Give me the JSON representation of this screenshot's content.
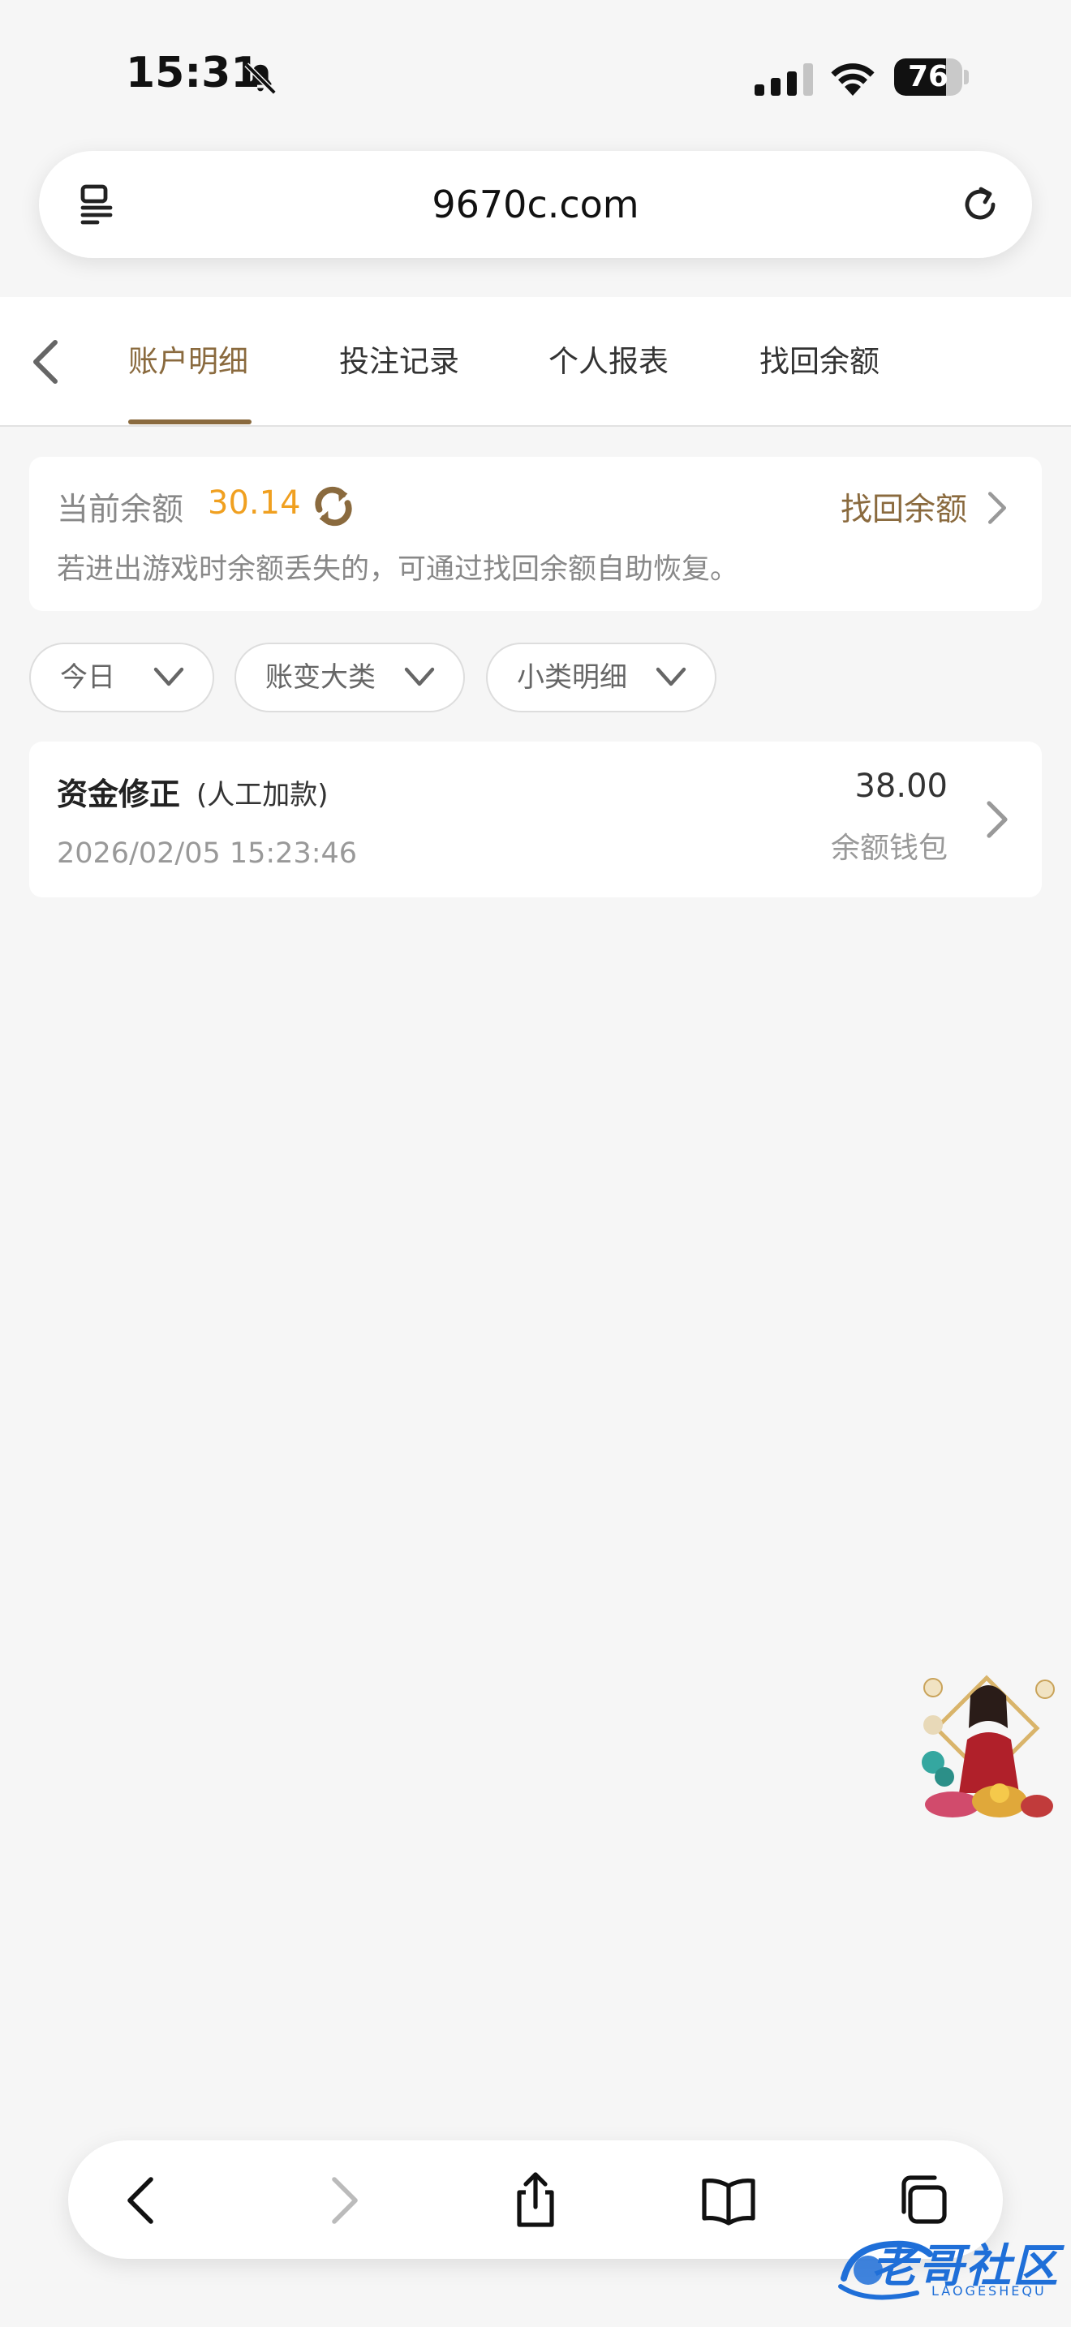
{
  "status_bar": {
    "time": "15:31",
    "battery": "76",
    "battery_level": 0.76
  },
  "browser": {
    "url": "9670c.com"
  },
  "tabs": [
    {
      "label": "账户明细",
      "active": true
    },
    {
      "label": "投注记录",
      "active": false
    },
    {
      "label": "个人报表",
      "active": false
    },
    {
      "label": "找回余额",
      "active": false
    }
  ],
  "balance": {
    "label": "当前余额",
    "value": "30.14",
    "recover_link": "找回余额",
    "hint": "若进出游戏时余额丢失的，可通过找回余额自助恢复。"
  },
  "filters": [
    {
      "label": "今日"
    },
    {
      "label": "账变大类"
    },
    {
      "label": "小类明细"
    }
  ],
  "transactions": [
    {
      "title": "资金修正",
      "subtitle": "(人工加款)",
      "date": "2026/02/05 15:23:46",
      "amount": "38.00",
      "wallet": "余额钱包"
    }
  ],
  "watermark": {
    "text": "老哥社区",
    "sub": "LAOGESHEQU"
  },
  "colors": {
    "accent": "#8a6a3e",
    "balance": "#f0a020",
    "watermark": "#1f6fd8"
  }
}
